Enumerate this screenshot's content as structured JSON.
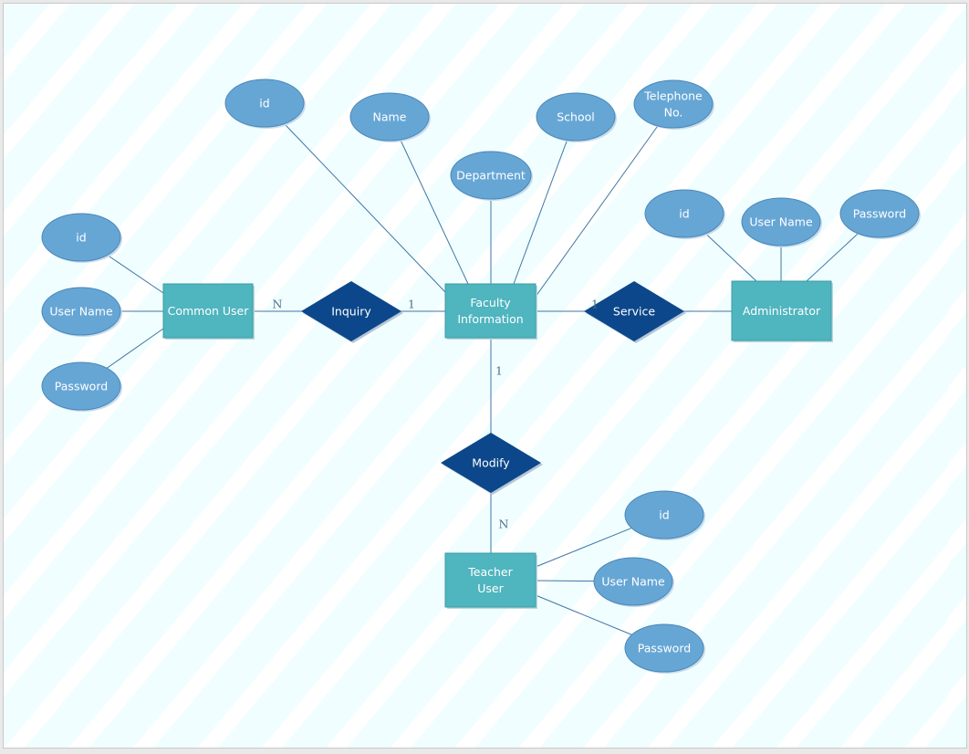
{
  "diagram": {
    "type": "entity-relationship",
    "entities": [
      {
        "id": "common_user",
        "label": [
          "Common User"
        ]
      },
      {
        "id": "faculty_information",
        "label": [
          "Faculty",
          "Information"
        ]
      },
      {
        "id": "administrator",
        "label": [
          "Administrator"
        ]
      },
      {
        "id": "teacher_user",
        "label": [
          "Teacher",
          "User"
        ]
      }
    ],
    "relationships": [
      {
        "id": "inquiry",
        "label": "Inquiry",
        "from": "common_user",
        "to": "faculty_information",
        "from_card": "N",
        "to_card": "1"
      },
      {
        "id": "service",
        "label": "Service",
        "from": "faculty_information",
        "to": "administrator",
        "from_card": "1",
        "to_card": ""
      },
      {
        "id": "modify",
        "label": "Modify",
        "from": "faculty_information",
        "to": "teacher_user",
        "from_card": "1",
        "to_card": "N"
      }
    ],
    "attributes": [
      {
        "id": "fi_id",
        "entity": "faculty_information",
        "label": [
          "id"
        ]
      },
      {
        "id": "fi_name",
        "entity": "faculty_information",
        "label": [
          "Name"
        ]
      },
      {
        "id": "fi_department",
        "entity": "faculty_information",
        "label": [
          "Department"
        ]
      },
      {
        "id": "fi_school",
        "entity": "faculty_information",
        "label": [
          "School"
        ]
      },
      {
        "id": "fi_telephone",
        "entity": "faculty_information",
        "label": [
          "Telephone",
          "No."
        ]
      },
      {
        "id": "cu_id",
        "entity": "common_user",
        "label": [
          "id"
        ]
      },
      {
        "id": "cu_username",
        "entity": "common_user",
        "label": [
          "User Name"
        ]
      },
      {
        "id": "cu_password",
        "entity": "common_user",
        "label": [
          "Password"
        ]
      },
      {
        "id": "ad_id",
        "entity": "administrator",
        "label": [
          "id"
        ]
      },
      {
        "id": "ad_username",
        "entity": "administrator",
        "label": [
          "User Name"
        ]
      },
      {
        "id": "ad_password",
        "entity": "administrator",
        "label": [
          "Password"
        ]
      },
      {
        "id": "tu_id",
        "entity": "teacher_user",
        "label": [
          "id"
        ]
      },
      {
        "id": "tu_username",
        "entity": "teacher_user",
        "label": [
          "User Name"
        ]
      },
      {
        "id": "tu_password",
        "entity": "teacher_user",
        "label": [
          "Password"
        ]
      }
    ]
  },
  "colors": {
    "entity": "#4fb5bf",
    "relationship": "#0b478a",
    "attribute": "#66a6d5",
    "connector": "#3f76a4",
    "background": "#f1feff"
  }
}
